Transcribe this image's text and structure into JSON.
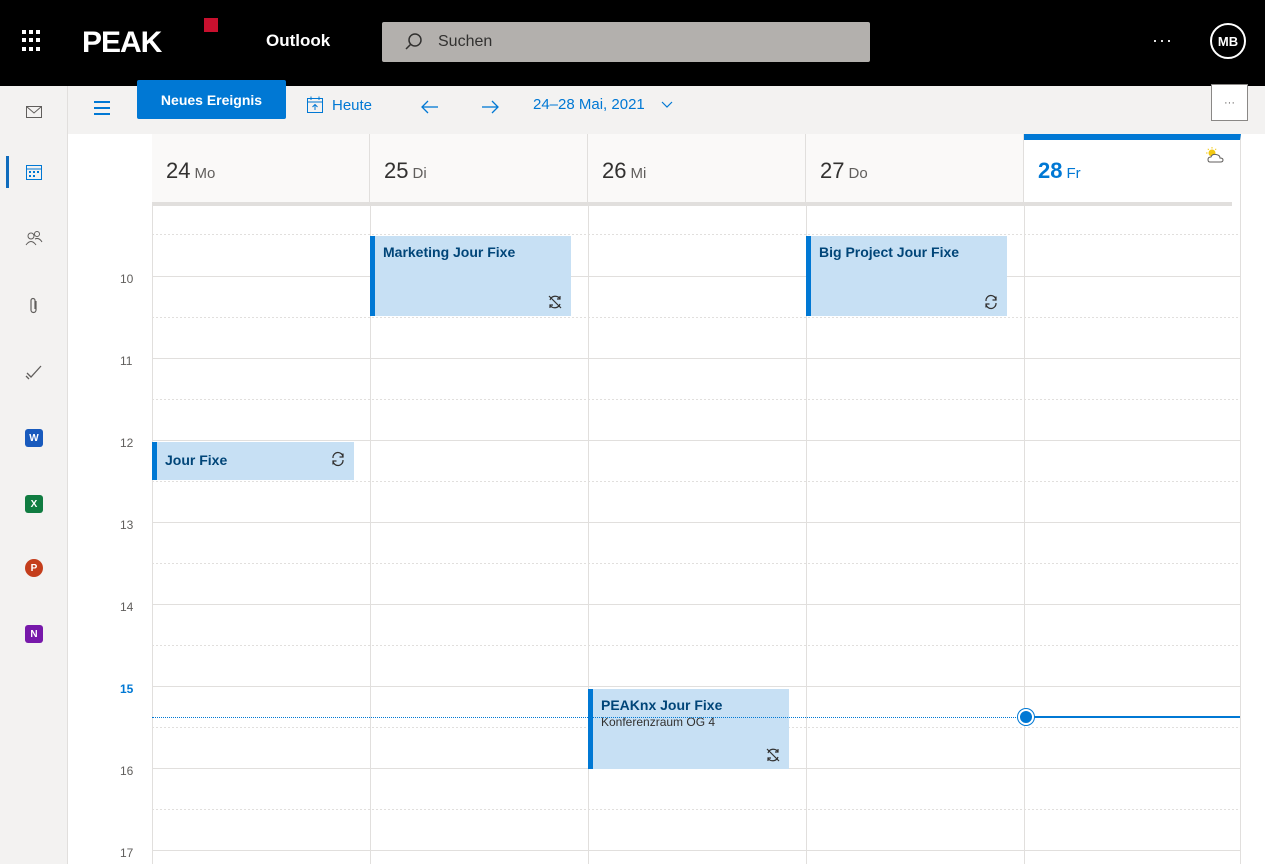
{
  "topbar": {
    "brand": "PEAK",
    "app_name": "Outlook",
    "search_placeholder": "Suchen",
    "more_label": "···",
    "avatar_initials": "MB"
  },
  "left_rail": {
    "items": [
      {
        "name": "mail-icon",
        "active": false
      },
      {
        "name": "calendar-icon",
        "active": true
      },
      {
        "name": "people-icon",
        "active": false
      },
      {
        "name": "attachment-icon",
        "active": false
      },
      {
        "name": "todo-icon",
        "active": false
      },
      {
        "name": "word-icon",
        "letter": "W",
        "color": "#185abd"
      },
      {
        "name": "excel-icon",
        "letter": "X",
        "color": "#107c41"
      },
      {
        "name": "powerpoint-icon",
        "letter": "P",
        "color": "#c43e1c"
      },
      {
        "name": "onenote-icon",
        "letter": "N",
        "color": "#7719aa"
      }
    ]
  },
  "toolbar": {
    "new_event_label": "Neues Ereignis",
    "today_label": "Heute",
    "date_range": "24–28 Mai, 2021",
    "more_label": "···"
  },
  "days": [
    {
      "num": "24",
      "name": "Mo",
      "today": false
    },
    {
      "num": "25",
      "name": "Di",
      "today": false
    },
    {
      "num": "26",
      "name": "Mi",
      "today": false
    },
    {
      "num": "27",
      "name": "Do",
      "today": false
    },
    {
      "num": "28",
      "name": "Fr",
      "today": true
    }
  ],
  "hours": [
    "10",
    "11",
    "12",
    "13",
    "14",
    "15",
    "16",
    "17"
  ],
  "current_hour": "15",
  "events": [
    {
      "title": "Marketing Jour Fixe",
      "location": "",
      "recurrence": "exception"
    },
    {
      "title": "Big Project Jour Fixe",
      "location": "",
      "recurrence": "recurring"
    },
    {
      "title": "Jour Fixe",
      "location": "",
      "recurrence": "recurring"
    },
    {
      "title": "PEAKnx Jour Fixe",
      "location": "Konferenzraum OG 4",
      "recurrence": "exception"
    }
  ],
  "colors": {
    "accent": "#0078d4",
    "event_bg": "#c7e0f4",
    "brand_red": "#c8102e"
  }
}
